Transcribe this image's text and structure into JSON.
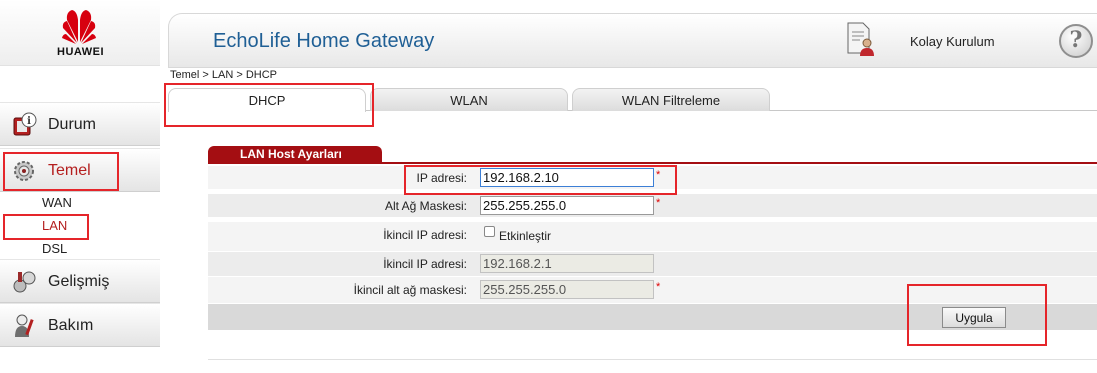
{
  "brand": {
    "name": "HUAWEI",
    "color": "#d7000f"
  },
  "header": {
    "title": "EchoLife Home Gateway",
    "wizard_label": "Kolay Kurulum",
    "wizard_icon": "user-document-icon",
    "help_icon": "help-icon",
    "help_symbol": "?"
  },
  "breadcrumb": "Temel > LAN > DHCP",
  "sidebar": {
    "items": [
      {
        "label": "Durum",
        "icon": "info-icon"
      },
      {
        "label": "Temel",
        "icon": "gear-icon",
        "active": true
      },
      {
        "label": "Gelişmiş",
        "icon": "advanced-tools-icon"
      },
      {
        "label": "Bakım",
        "icon": "maintenance-icon"
      }
    ],
    "sub_items": [
      {
        "label": "WAN"
      },
      {
        "label": "LAN",
        "active": true
      },
      {
        "label": "DSL"
      }
    ]
  },
  "tabs": [
    {
      "label": "DHCP",
      "active": true
    },
    {
      "label": "WLAN"
    },
    {
      "label": "WLAN Filtreleme"
    }
  ],
  "section": {
    "title": "LAN Host Ayarları",
    "accent_color": "#a40e12",
    "fields": [
      {
        "label": "IP adresi:",
        "value": "192.168.2.10",
        "required_mark": "*"
      },
      {
        "label": "Alt Ağ Maskesi:",
        "value": "255.255.255.0",
        "required_mark": "*"
      },
      {
        "label": "İkincil IP adresi:",
        "checkbox_label": "Etkinleştir",
        "checked": false
      },
      {
        "label": "İkincil IP adresi:",
        "value": "192.168.2.1",
        "disabled": true
      },
      {
        "label": "İkincil alt ağ maskesi:",
        "value": "255.255.255.0",
        "disabled": true,
        "required_mark": "*"
      }
    ],
    "apply_label": "Uygula"
  },
  "annotation_color": "#e5252a"
}
